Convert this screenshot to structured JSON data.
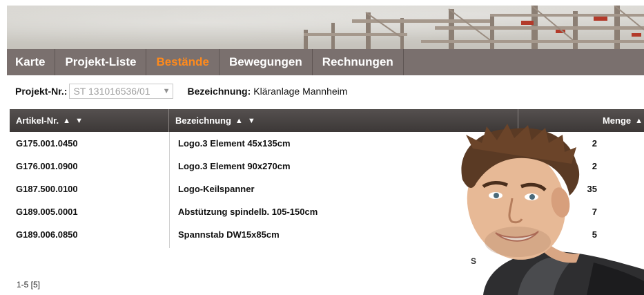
{
  "nav": {
    "tabs": [
      {
        "label": "Karte"
      },
      {
        "label": "Projekt-Liste"
      },
      {
        "label": "Bestände"
      },
      {
        "label": "Bewegungen"
      },
      {
        "label": "Rechnungen"
      }
    ],
    "active_index": 2
  },
  "filter": {
    "project_label": "Projekt-Nr.:",
    "project_value": "ST 131016536/01",
    "description_label": "Bezeichnung:",
    "description_value": "Kläranlage Mannheim"
  },
  "table": {
    "headers": {
      "artikel": "Artikel-Nr.",
      "bezeichnung": "Bezeichnung",
      "menge": "Menge",
      "sort_glyphs": "▲ ▼"
    },
    "rows": [
      {
        "artikel": "G175.001.0450",
        "bezeichnung": "Logo.3 Element 45x135cm",
        "menge": "2"
      },
      {
        "artikel": "G176.001.0900",
        "bezeichnung": "Logo.3 Element 90x270cm",
        "menge": "2"
      },
      {
        "artikel": "G187.500.0100",
        "bezeichnung": "Logo-Keilspanner",
        "menge": "35"
      },
      {
        "artikel": "G189.005.0001",
        "bezeichnung": "Abstützung spindelb. 105-150cm",
        "menge": "7"
      },
      {
        "artikel": "G189.006.0850",
        "bezeichnung": "Spannstab DW15x85cm",
        "menge": "5"
      }
    ],
    "partial_text": "S",
    "pager": "1-5 [5]"
  },
  "colors": {
    "nav_bg": "#7a706e",
    "active_tab": "#ff8a1c",
    "table_header": "#4a4544"
  }
}
